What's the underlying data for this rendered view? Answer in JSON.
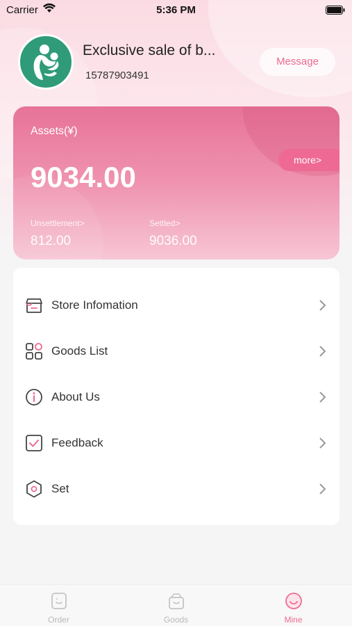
{
  "status_bar": {
    "carrier": "Carrier",
    "time": "5:36 PM"
  },
  "header": {
    "store_name": "Exclusive sale of b...",
    "phone": "15787903491",
    "message_label": "Message"
  },
  "assets": {
    "label": "Assets(¥)",
    "value": "9034.00",
    "more_label": "more>",
    "unsettlement_label": "Unsettlement>",
    "unsettlement_value": "812.00",
    "settled_label": "Settled>",
    "settled_value": "9036.00"
  },
  "menu": {
    "items": [
      {
        "label": "Store Infomation",
        "icon": "store-icon"
      },
      {
        "label": "Goods List",
        "icon": "grid-icon"
      },
      {
        "label": "About Us",
        "icon": "info-icon"
      },
      {
        "label": "Feedback",
        "icon": "feedback-check-icon"
      },
      {
        "label": "Set",
        "icon": "hexagon-settings-icon"
      }
    ]
  },
  "tabs": [
    {
      "label": "Order",
      "icon": "order-icon",
      "active": false
    },
    {
      "label": "Goods",
      "icon": "goods-box-icon",
      "active": false
    },
    {
      "label": "Mine",
      "icon": "mine-smile-icon",
      "active": true
    }
  ],
  "colors": {
    "accent": "#ec6b92",
    "card_top": "#e77399",
    "avatar_bg": "#2f9b78"
  }
}
